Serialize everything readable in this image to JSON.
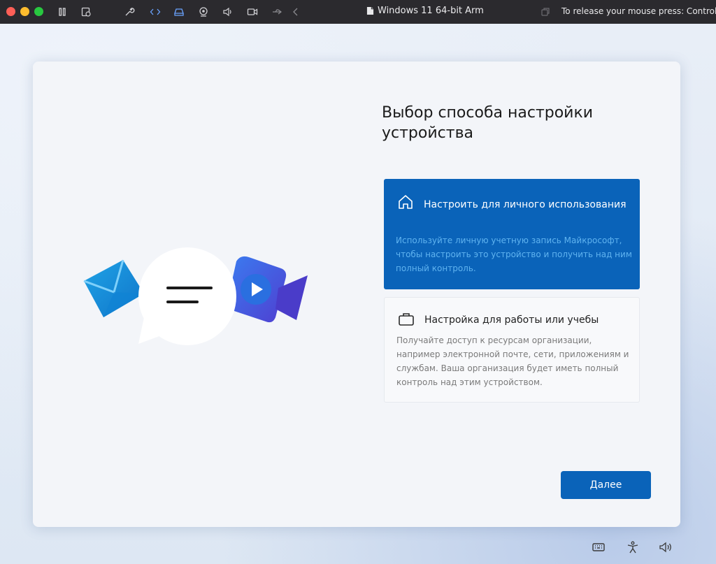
{
  "vm_toolbar": {
    "window_title": "Windows 11 64-bit Arm",
    "release_hint": "To release your mouse press: Control-⌘",
    "colors": {
      "close": "#fe5f57",
      "minimize": "#febc2e",
      "zoom": "#28c840"
    },
    "icons": [
      "pause-icon",
      "snapshot-icon",
      "settings-icon",
      "code-icon",
      "drive-icon",
      "camera-icon",
      "volume-icon",
      "video-icon",
      "usb-icon",
      "back-icon",
      "copy-icon"
    ]
  },
  "setup": {
    "heading": "Выбор способа настройки устройства",
    "options": [
      {
        "title": "Настроить для личного использования",
        "description": "Используйте личную учетную запись Майкрософт, чтобы настроить это устройство и получить над ним полный контроль.",
        "icon": "home-icon",
        "selected": true
      },
      {
        "title": "Настройка для работы или учебы",
        "description": "Получайте доступ к ресурсам организации, например электронной почте, сети, приложениям и службам. Ваша организация будет иметь полный контроль над этим устройством.",
        "icon": "briefcase-icon",
        "selected": false
      }
    ],
    "next_button": "Далее",
    "accent_color": "#0a63b9"
  },
  "tray": {
    "icons": [
      "keyboard-icon",
      "accessibility-icon",
      "volume-icon"
    ]
  }
}
